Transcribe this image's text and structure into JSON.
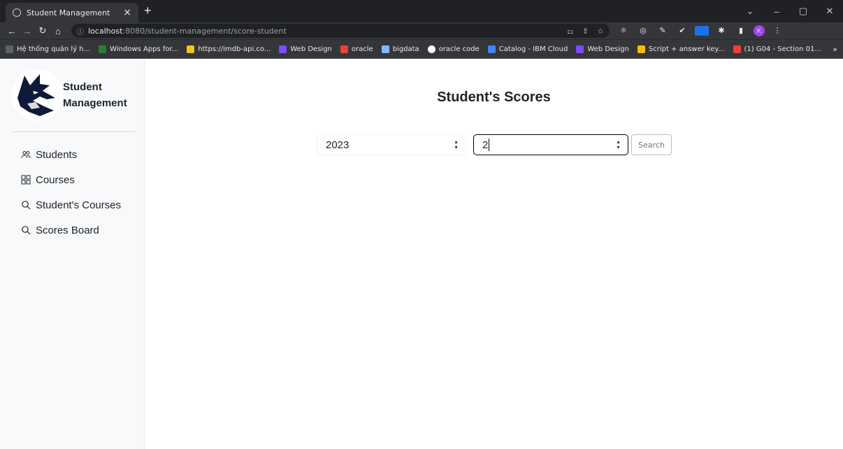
{
  "browser": {
    "tab_title": "Student Management",
    "tab_close": "×",
    "new_tab": "+",
    "url_host": "localhost",
    "url_path": ":8080/student-management/score-student",
    "window_controls": [
      "⌄",
      "–",
      "▢",
      "✕"
    ],
    "bookmarks": [
      {
        "label": "Hệ thống quản lý h...",
        "color": "#5f6368"
      },
      {
        "label": "Windows Apps for...",
        "color": "#2e7d32"
      },
      {
        "label": "https://imdb-api.co...",
        "color": "#f5c518"
      },
      {
        "label": "Web Design",
        "color": "#7c4dff"
      },
      {
        "label": "oracle",
        "color": "#ea4335"
      },
      {
        "label": "bigdata",
        "color": "#8ab4f8"
      },
      {
        "label": "oracle code",
        "color": "#ffffff"
      },
      {
        "label": "Catalog - IBM Cloud",
        "color": "#4285f4"
      },
      {
        "label": "Web Design",
        "color": "#7c4dff"
      },
      {
        "label": "Script + answer key...",
        "color": "#fbbc04"
      },
      {
        "label": "(1) G04 - Section 01...",
        "color": "#ea4335"
      }
    ],
    "bookmarks_more": "»",
    "profile_initial": "K"
  },
  "sidebar": {
    "brand_line1": "Student",
    "brand_line2": "Management",
    "items": [
      {
        "label": "Students",
        "icon": "people-icon"
      },
      {
        "label": "Courses",
        "icon": "grid-icon"
      },
      {
        "label": "Student's Courses",
        "icon": "search-icon"
      },
      {
        "label": "Scores Board",
        "icon": "search-icon"
      }
    ]
  },
  "main": {
    "title": "Student's Scores",
    "year_value": "2023",
    "semester_value": "2",
    "search_label": "Search"
  }
}
